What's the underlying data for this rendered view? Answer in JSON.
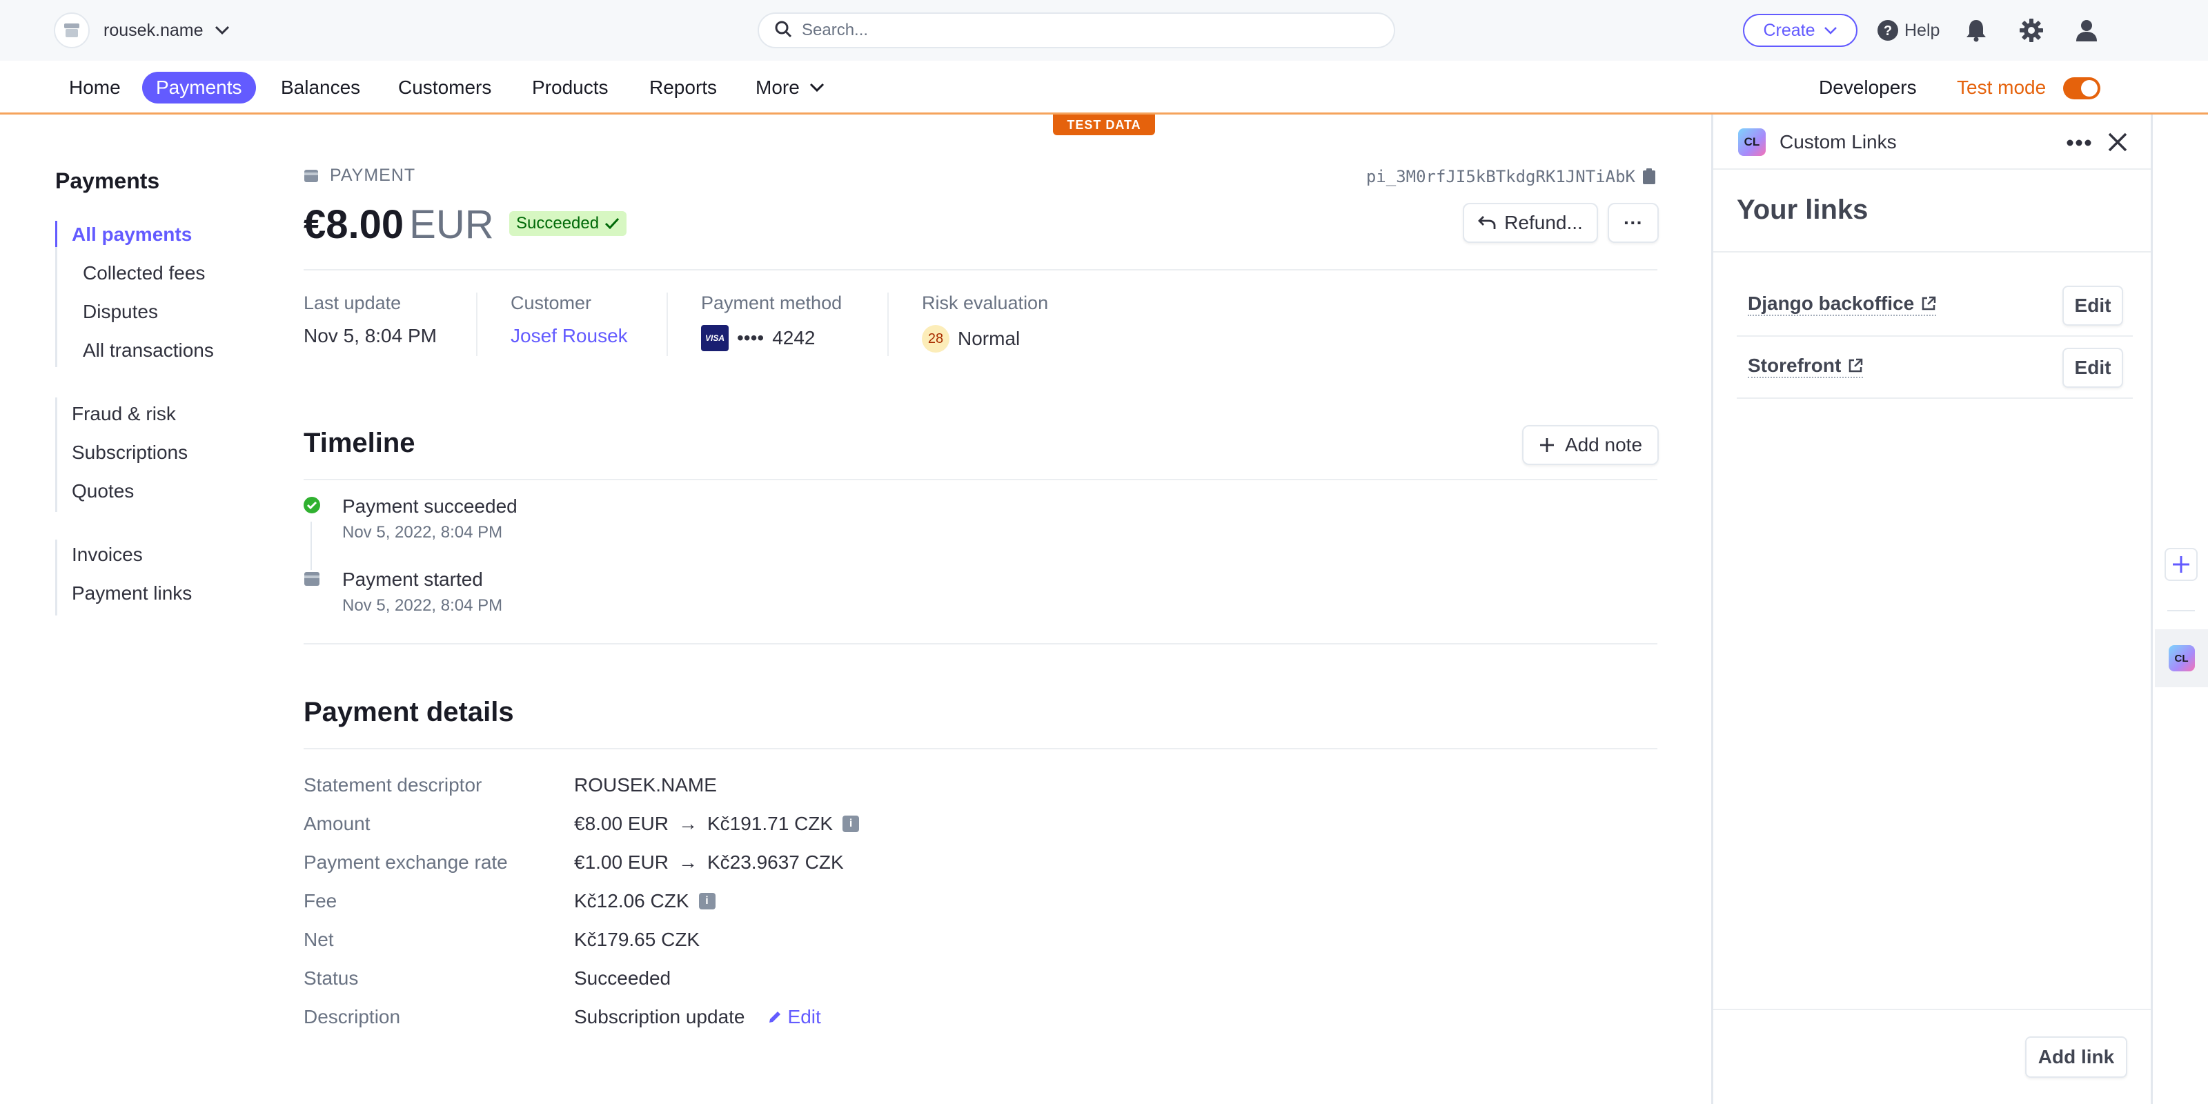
{
  "account": {
    "name": "rousek.name"
  },
  "search": {
    "placeholder": "Search..."
  },
  "topbar": {
    "create_label": "Create",
    "help_label": "Help"
  },
  "nav": {
    "items": [
      "Home",
      "Payments",
      "Balances",
      "Customers",
      "Products",
      "Reports",
      "More"
    ],
    "active": "Payments",
    "developers": "Developers",
    "test_mode": "Test mode",
    "test_mode_on": true
  },
  "test_data_label": "TEST DATA",
  "sidebar": {
    "title": "Payments",
    "items": [
      {
        "label": "All payments",
        "active": true
      },
      {
        "label": "Collected fees"
      },
      {
        "label": "Disputes"
      },
      {
        "label": "All transactions"
      },
      {
        "label": "Fraud & risk"
      },
      {
        "label": "Subscriptions"
      },
      {
        "label": "Quotes"
      },
      {
        "label": "Invoices"
      },
      {
        "label": "Payment links"
      }
    ]
  },
  "payment": {
    "label": "PAYMENT",
    "id": "pi_3M0rfJI5kBTkdgRK1JNTiAbK",
    "amount": "€8.00",
    "currency": "EUR",
    "status": "Succeeded",
    "refund_label": "Refund...",
    "more_label": "···",
    "meta": {
      "last_update_label": "Last update",
      "last_update": "Nov 5, 8:04 PM",
      "customer_label": "Customer",
      "customer": "Josef Rousek",
      "method_label": "Payment method",
      "card_brand": "VISA",
      "card_dots": "••••",
      "card_last4": "4242",
      "risk_label": "Risk evaluation",
      "risk_score": "28",
      "risk_level": "Normal"
    }
  },
  "timeline": {
    "title": "Timeline",
    "add_note": "Add note",
    "events": [
      {
        "title": "Payment succeeded",
        "date": "Nov 5, 2022, 8:04 PM",
        "icon": "check-circle-icon"
      },
      {
        "title": "Payment started",
        "date": "Nov 5, 2022, 8:04 PM",
        "icon": "payment-card-icon"
      }
    ]
  },
  "details": {
    "title": "Payment details",
    "rows": [
      {
        "label": "Statement descriptor",
        "value": "ROUSEK.NAME"
      },
      {
        "label": "Amount",
        "value": "€8.00 EUR",
        "arrow": "→",
        "value2": "Kč191.71 CZK",
        "info": "i"
      },
      {
        "label": "Payment exchange rate",
        "value": "€1.00 EUR",
        "arrow": "→",
        "value2": "Kč23.9637 CZK"
      },
      {
        "label": "Fee",
        "value": "Kč12.06 CZK",
        "info": "i"
      },
      {
        "label": "Net",
        "value": "Kč179.65 CZK"
      },
      {
        "label": "Status",
        "value": "Succeeded"
      },
      {
        "label": "Description",
        "value": "Subscription update",
        "edit": "Edit"
      }
    ]
  },
  "panel": {
    "app_abbr": "CL",
    "title": "Custom Links",
    "heading": "Your links",
    "links": [
      {
        "name": "Django backoffice",
        "edit": "Edit"
      },
      {
        "name": "Storefront",
        "edit": "Edit"
      }
    ],
    "add_link": "Add link"
  },
  "colors": {
    "accent": "#635bff",
    "test_mode": "#e5620c",
    "success_bg": "#d7f7c2",
    "success_text": "#006908"
  }
}
